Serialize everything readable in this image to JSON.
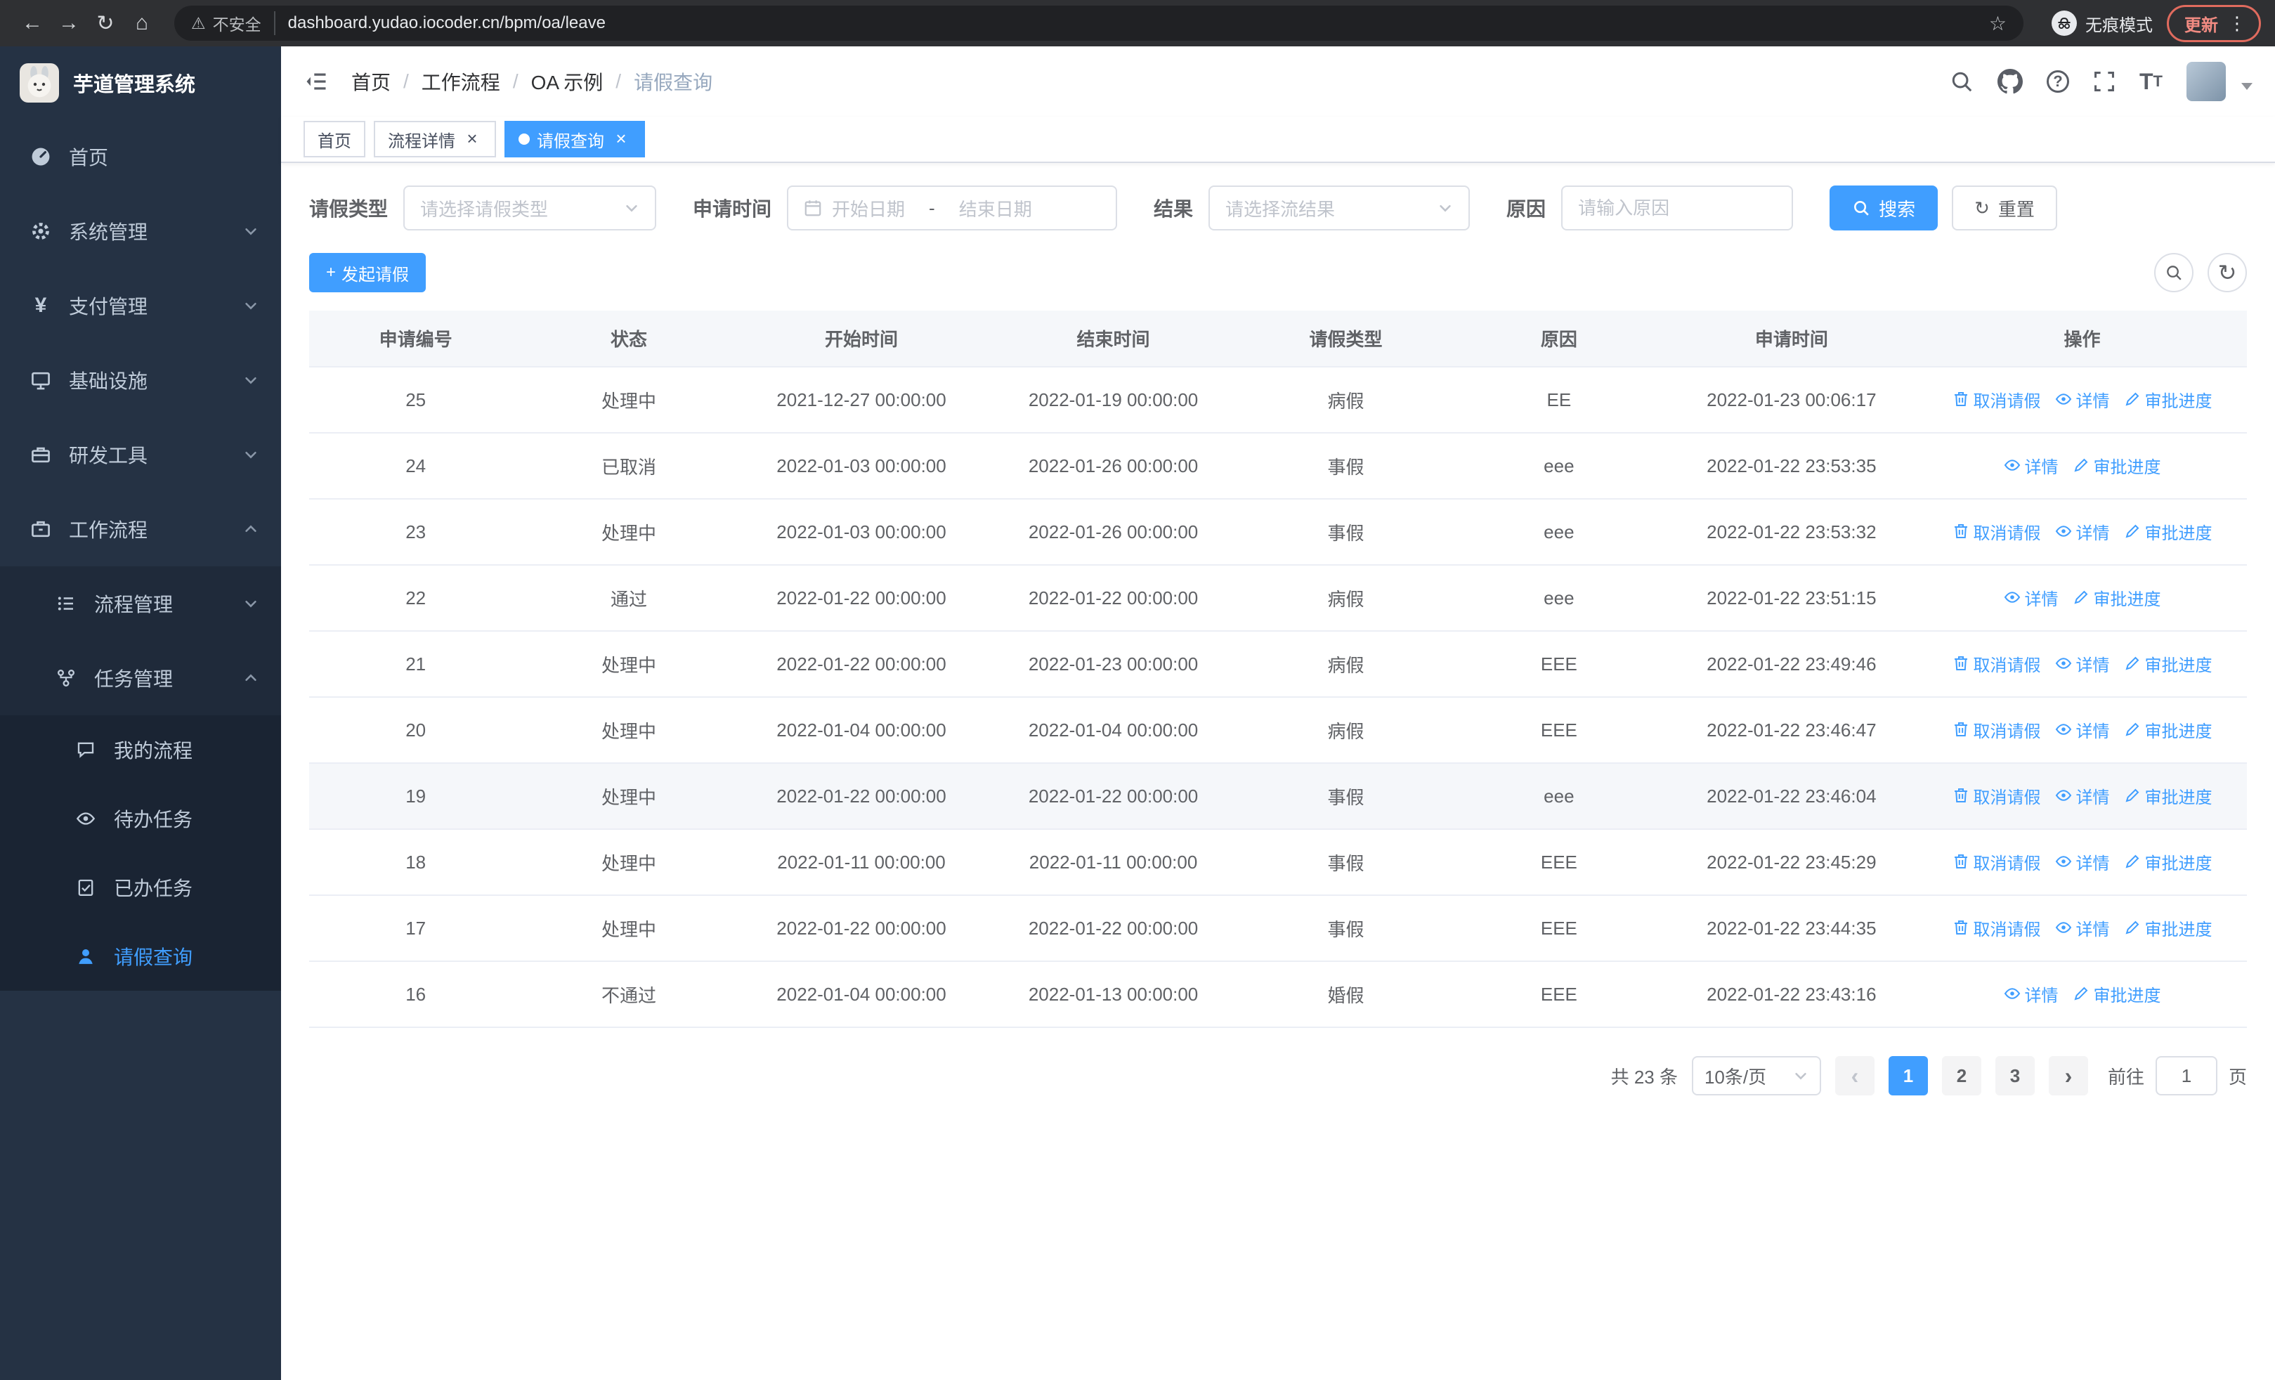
{
  "theme": {
    "primary": "#409eff"
  },
  "icons": {
    "back": "←",
    "forward": "→",
    "refresh": "↻",
    "home": "⌂",
    "warning": "⚠",
    "star": "☆",
    "menu_dots": "⋮",
    "prev": "‹",
    "next": "›",
    "plus": "+",
    "close": "×",
    "question": "?",
    "font_big": "T",
    "font_small": "T"
  },
  "browser": {
    "security_label": "不安全",
    "url": "dashboard.yudao.iocoder.cn/bpm/oa/leave",
    "incognito_label": "无痕模式",
    "update_label": "更新"
  },
  "sidebar": {
    "app_title": "芋道管理系统",
    "items": [
      {
        "label": "首页"
      },
      {
        "label": "系统管理"
      },
      {
        "label": "支付管理"
      },
      {
        "label": "基础设施"
      },
      {
        "label": "研发工具"
      },
      {
        "label": "工作流程"
      },
      {
        "label": "流程管理"
      },
      {
        "label": "任务管理"
      },
      {
        "label": "我的流程"
      },
      {
        "label": "待办任务"
      },
      {
        "label": "已办任务"
      },
      {
        "label": "请假查询"
      }
    ]
  },
  "header": {
    "breadcrumb": [
      "首页",
      "工作流程",
      "OA 示例",
      "请假查询"
    ]
  },
  "tabs": [
    {
      "label": "首页"
    },
    {
      "label": "流程详情"
    },
    {
      "label": "请假查询"
    }
  ],
  "filters": {
    "leave_type_label": "请假类型",
    "leave_type_placeholder": "请选择请假类型",
    "apply_time_label": "申请时间",
    "start_date_placeholder": "开始日期",
    "range_separator": "-",
    "end_date_placeholder": "结束日期",
    "result_label": "结果",
    "result_placeholder": "请选择流结果",
    "reason_label": "原因",
    "reason_placeholder": "请输入原因",
    "search_button": "搜索",
    "reset_button": "重置"
  },
  "toolbar": {
    "create_button": "发起请假"
  },
  "action_labels": {
    "cancel": "取消请假",
    "detail": "详情",
    "progress": "审批进度"
  },
  "table": {
    "columns": [
      "申请编号",
      "状态",
      "开始时间",
      "结束时间",
      "请假类型",
      "原因",
      "申请时间",
      "操作"
    ],
    "rows": [
      {
        "id": "25",
        "status": "处理中",
        "start": "2021-12-27 00:00:00",
        "end": "2022-01-19 00:00:00",
        "type": "病假",
        "reason": "EE",
        "applied": "2022-01-23 00:06:17",
        "actions": [
          "cancel",
          "detail",
          "progress"
        ],
        "highlighted": false
      },
      {
        "id": "24",
        "status": "已取消",
        "start": "2022-01-03 00:00:00",
        "end": "2022-01-26 00:00:00",
        "type": "事假",
        "reason": "eee",
        "applied": "2022-01-22 23:53:35",
        "actions": [
          "detail",
          "progress"
        ],
        "highlighted": false
      },
      {
        "id": "23",
        "status": "处理中",
        "start": "2022-01-03 00:00:00",
        "end": "2022-01-26 00:00:00",
        "type": "事假",
        "reason": "eee",
        "applied": "2022-01-22 23:53:32",
        "actions": [
          "cancel",
          "detail",
          "progress"
        ],
        "highlighted": false
      },
      {
        "id": "22",
        "status": "通过",
        "start": "2022-01-22 00:00:00",
        "end": "2022-01-22 00:00:00",
        "type": "病假",
        "reason": "eee",
        "applied": "2022-01-22 23:51:15",
        "actions": [
          "detail",
          "progress"
        ],
        "highlighted": false
      },
      {
        "id": "21",
        "status": "处理中",
        "start": "2022-01-22 00:00:00",
        "end": "2022-01-23 00:00:00",
        "type": "病假",
        "reason": "EEE",
        "applied": "2022-01-22 23:49:46",
        "actions": [
          "cancel",
          "detail",
          "progress"
        ],
        "highlighted": false
      },
      {
        "id": "20",
        "status": "处理中",
        "start": "2022-01-04 00:00:00",
        "end": "2022-01-04 00:00:00",
        "type": "病假",
        "reason": "EEE",
        "applied": "2022-01-22 23:46:47",
        "actions": [
          "cancel",
          "detail",
          "progress"
        ],
        "highlighted": false
      },
      {
        "id": "19",
        "status": "处理中",
        "start": "2022-01-22 00:00:00",
        "end": "2022-01-22 00:00:00",
        "type": "事假",
        "reason": "eee",
        "applied": "2022-01-22 23:46:04",
        "actions": [
          "cancel",
          "detail",
          "progress"
        ],
        "highlighted": true
      },
      {
        "id": "18",
        "status": "处理中",
        "start": "2022-01-11 00:00:00",
        "end": "2022-01-11 00:00:00",
        "type": "事假",
        "reason": "EEE",
        "applied": "2022-01-22 23:45:29",
        "actions": [
          "cancel",
          "detail",
          "progress"
        ],
        "highlighted": false
      },
      {
        "id": "17",
        "status": "处理中",
        "start": "2022-01-22 00:00:00",
        "end": "2022-01-22 00:00:00",
        "type": "事假",
        "reason": "EEE",
        "applied": "2022-01-22 23:44:35",
        "actions": [
          "cancel",
          "detail",
          "progress"
        ],
        "highlighted": false
      },
      {
        "id": "16",
        "status": "不通过",
        "start": "2022-01-04 00:00:00",
        "end": "2022-01-13 00:00:00",
        "type": "婚假",
        "reason": "EEE",
        "applied": "2022-01-22 23:43:16",
        "actions": [
          "detail",
          "progress"
        ],
        "highlighted": false
      }
    ]
  },
  "pagination": {
    "total_text": "共 23 条",
    "page_size": "10条/页",
    "pages": [
      "1",
      "2",
      "3"
    ],
    "active_page": "1",
    "goto_label": "前往",
    "goto_value": "1",
    "goto_suffix": "页"
  }
}
